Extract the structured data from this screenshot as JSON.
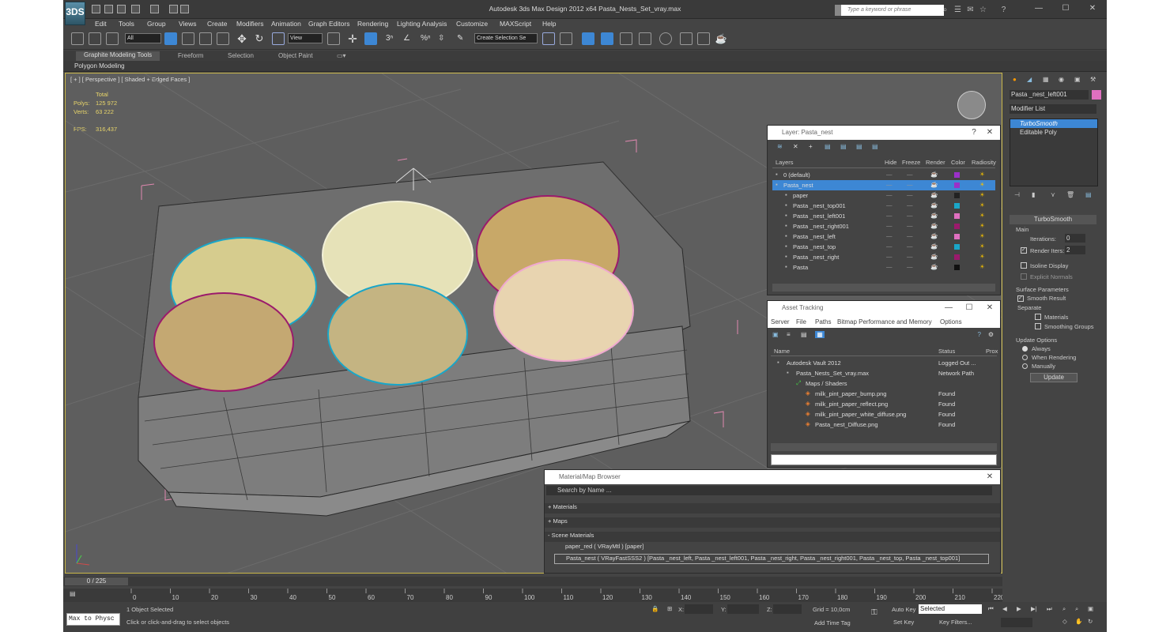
{
  "app": {
    "title": "Autodesk 3ds Max Design 2012 x64      Pasta_Nests_Set_vray.max",
    "search_placeholder": "Type a keyword or phrase",
    "logo": "3DS"
  },
  "menus": [
    "Edit",
    "Tools",
    "Group",
    "Views",
    "Create",
    "Modifiers",
    "Animation",
    "Graph Editors",
    "Rendering",
    "Lighting Analysis",
    "Customize",
    "MAXScript",
    "Help"
  ],
  "toolbar": {
    "selection_filter": "All",
    "ref_coord": "View",
    "named_selection": "Create Selection Se"
  },
  "ribbon": {
    "tabs": [
      "Graphite Modeling Tools",
      "Freeform",
      "Selection",
      "Object Paint"
    ],
    "sub": "Polygon Modeling"
  },
  "viewport": {
    "label": "[ + ] [ Perspective ] [ Shaded + Edged Faces ]",
    "stats": {
      "total_label": "Total",
      "polys_label": "Polys:",
      "polys": "125 972",
      "verts_label": "Verts:",
      "verts": "63 222",
      "fps_label": "FPS:",
      "fps": "316,437"
    }
  },
  "layer_panel": {
    "title": "Layer: Pasta_nest",
    "headers": [
      "Layers",
      "Hide",
      "Freeze",
      "Render",
      "Color",
      "Radiosity"
    ],
    "rows": [
      {
        "name": "0 (default)",
        "color": "#9b30c8",
        "level": 0
      },
      {
        "name": "Pasta_nest",
        "color": "#9b30c8",
        "level": 0,
        "selected": true
      },
      {
        "name": "paper",
        "color": "#222222",
        "level": 1
      },
      {
        "name": "Pasta _nest_top001",
        "color": "#1aa6c8",
        "level": 1
      },
      {
        "name": "Pasta _nest_left001",
        "color": "#e070c0",
        "level": 1
      },
      {
        "name": "Pasta _nest_right001",
        "color": "#9b1a6c",
        "level": 1
      },
      {
        "name": "Pasta _nest_left",
        "color": "#e070c0",
        "level": 1
      },
      {
        "name": "Pasta _nest_top",
        "color": "#1aa6c8",
        "level": 1
      },
      {
        "name": "Pasta _nest_right",
        "color": "#9b1a6c",
        "level": 1
      },
      {
        "name": "Pasta",
        "color": "#111111",
        "level": 1
      }
    ]
  },
  "asset_panel": {
    "title": "Asset Tracking",
    "menus": [
      "Server",
      "File",
      "Paths",
      "Bitmap Performance and Memory",
      "Options"
    ],
    "headers": [
      "Name",
      "Status",
      "Prox"
    ],
    "rows": [
      {
        "name": "Autodesk Vault 2012",
        "status": "Logged Out ...",
        "level": 0
      },
      {
        "name": "Pasta_Nests_Set_vray.max",
        "status": "Network Path",
        "level": 1
      },
      {
        "name": "Maps / Shaders",
        "status": "",
        "level": 2
      },
      {
        "name": "milk_pint_paper_bump.png",
        "status": "Found",
        "level": 3
      },
      {
        "name": "milk_pint_paper_reflect.png",
        "status": "Found",
        "level": 3
      },
      {
        "name": "milk_pint_paper_white_diffuse.png",
        "status": "Found",
        "level": 3
      },
      {
        "name": "Pasta_nest_Diffuse.png",
        "status": "Found",
        "level": 3
      }
    ]
  },
  "material_browser": {
    "title": "Material/Map Browser",
    "search": "Search by Name ...",
    "groups": [
      "+ Materials",
      "+ Maps",
      "- Scene Materials"
    ],
    "items": [
      "paper_red  ( VRayMtl ) [paper]",
      "Pasta_nest  ( VRayFastSSS2 ) [Pasta _nest_left, Pasta _nest_left001, Pasta _nest_right, Pasta _nest_right001, Pasta _nest_top, Pasta _nest_top001]"
    ]
  },
  "command_panel": {
    "object_name": "Pasta _nest_left001",
    "modifier_list": "Modifier List",
    "stack": [
      "TurboSmooth",
      "Editable Poly"
    ],
    "turbosmooth": {
      "title": "TurboSmooth",
      "main": "Main",
      "iterations_label": "Iterations:",
      "iterations": "0",
      "render_iters_label": "Render Iters:",
      "render_iters": "2",
      "isoline": "Isoline Display",
      "explicit": "Explicit Normals",
      "surface": "Surface Parameters",
      "smooth_result": "Smooth Result",
      "separate": "Separate",
      "materials": "Materials",
      "smoothing_groups": "Smoothing Groups",
      "update_options": "Update Options",
      "always": "Always",
      "when_rendering": "When Rendering",
      "manually": "Manually",
      "update": "Update"
    }
  },
  "timeline": {
    "position": "0 / 225",
    "ticks": [
      "0",
      "10",
      "20",
      "30",
      "40",
      "50",
      "60",
      "70",
      "80",
      "90",
      "100",
      "110",
      "120",
      "130",
      "140",
      "150",
      "160",
      "170",
      "180",
      "190",
      "200",
      "210",
      "220"
    ]
  },
  "status": {
    "selected": "1 Object Selected",
    "hint": "Click or click-and-drag to select objects",
    "script_label": "Max to Physc",
    "x_label": "X:",
    "y_label": "Y:",
    "z_label": "Z:",
    "grid": "Grid = 10,0cm",
    "auto_key": "Auto Key",
    "selected_dropdown": "Selected",
    "set_key": "Set Key",
    "key_filters": "Key Filters...",
    "add_time_tag": "Add Time Tag"
  },
  "colors": {
    "accent_blue": "#3d87d4",
    "viewport_border": "#c9b74a",
    "stats": "#e8d56a"
  }
}
